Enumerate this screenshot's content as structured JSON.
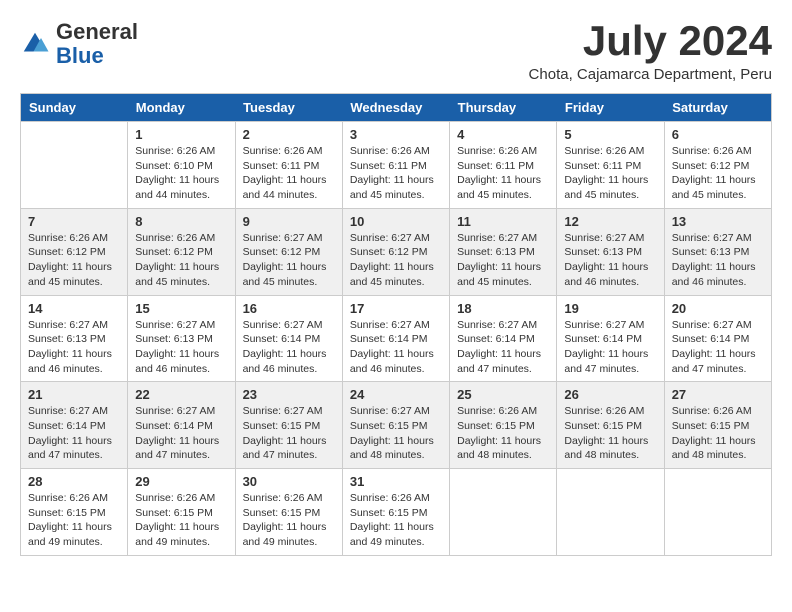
{
  "logo": {
    "general": "General",
    "blue": "Blue"
  },
  "header": {
    "month": "July 2024",
    "location": "Chota, Cajamarca Department, Peru"
  },
  "days": [
    "Sunday",
    "Monday",
    "Tuesday",
    "Wednesday",
    "Thursday",
    "Friday",
    "Saturday"
  ],
  "weeks": [
    [
      {
        "num": "",
        "sunrise": "",
        "sunset": "",
        "daylight": ""
      },
      {
        "num": "1",
        "sunrise": "Sunrise: 6:26 AM",
        "sunset": "Sunset: 6:10 PM",
        "daylight": "Daylight: 11 hours and 44 minutes."
      },
      {
        "num": "2",
        "sunrise": "Sunrise: 6:26 AM",
        "sunset": "Sunset: 6:11 PM",
        "daylight": "Daylight: 11 hours and 44 minutes."
      },
      {
        "num": "3",
        "sunrise": "Sunrise: 6:26 AM",
        "sunset": "Sunset: 6:11 PM",
        "daylight": "Daylight: 11 hours and 45 minutes."
      },
      {
        "num": "4",
        "sunrise": "Sunrise: 6:26 AM",
        "sunset": "Sunset: 6:11 PM",
        "daylight": "Daylight: 11 hours and 45 minutes."
      },
      {
        "num": "5",
        "sunrise": "Sunrise: 6:26 AM",
        "sunset": "Sunset: 6:11 PM",
        "daylight": "Daylight: 11 hours and 45 minutes."
      },
      {
        "num": "6",
        "sunrise": "Sunrise: 6:26 AM",
        "sunset": "Sunset: 6:12 PM",
        "daylight": "Daylight: 11 hours and 45 minutes."
      }
    ],
    [
      {
        "num": "7",
        "sunrise": "Sunrise: 6:26 AM",
        "sunset": "Sunset: 6:12 PM",
        "daylight": "Daylight: 11 hours and 45 minutes."
      },
      {
        "num": "8",
        "sunrise": "Sunrise: 6:26 AM",
        "sunset": "Sunset: 6:12 PM",
        "daylight": "Daylight: 11 hours and 45 minutes."
      },
      {
        "num": "9",
        "sunrise": "Sunrise: 6:27 AM",
        "sunset": "Sunset: 6:12 PM",
        "daylight": "Daylight: 11 hours and 45 minutes."
      },
      {
        "num": "10",
        "sunrise": "Sunrise: 6:27 AM",
        "sunset": "Sunset: 6:12 PM",
        "daylight": "Daylight: 11 hours and 45 minutes."
      },
      {
        "num": "11",
        "sunrise": "Sunrise: 6:27 AM",
        "sunset": "Sunset: 6:13 PM",
        "daylight": "Daylight: 11 hours and 45 minutes."
      },
      {
        "num": "12",
        "sunrise": "Sunrise: 6:27 AM",
        "sunset": "Sunset: 6:13 PM",
        "daylight": "Daylight: 11 hours and 46 minutes."
      },
      {
        "num": "13",
        "sunrise": "Sunrise: 6:27 AM",
        "sunset": "Sunset: 6:13 PM",
        "daylight": "Daylight: 11 hours and 46 minutes."
      }
    ],
    [
      {
        "num": "14",
        "sunrise": "Sunrise: 6:27 AM",
        "sunset": "Sunset: 6:13 PM",
        "daylight": "Daylight: 11 hours and 46 minutes."
      },
      {
        "num": "15",
        "sunrise": "Sunrise: 6:27 AM",
        "sunset": "Sunset: 6:13 PM",
        "daylight": "Daylight: 11 hours and 46 minutes."
      },
      {
        "num": "16",
        "sunrise": "Sunrise: 6:27 AM",
        "sunset": "Sunset: 6:14 PM",
        "daylight": "Daylight: 11 hours and 46 minutes."
      },
      {
        "num": "17",
        "sunrise": "Sunrise: 6:27 AM",
        "sunset": "Sunset: 6:14 PM",
        "daylight": "Daylight: 11 hours and 46 minutes."
      },
      {
        "num": "18",
        "sunrise": "Sunrise: 6:27 AM",
        "sunset": "Sunset: 6:14 PM",
        "daylight": "Daylight: 11 hours and 47 minutes."
      },
      {
        "num": "19",
        "sunrise": "Sunrise: 6:27 AM",
        "sunset": "Sunset: 6:14 PM",
        "daylight": "Daylight: 11 hours and 47 minutes."
      },
      {
        "num": "20",
        "sunrise": "Sunrise: 6:27 AM",
        "sunset": "Sunset: 6:14 PM",
        "daylight": "Daylight: 11 hours and 47 minutes."
      }
    ],
    [
      {
        "num": "21",
        "sunrise": "Sunrise: 6:27 AM",
        "sunset": "Sunset: 6:14 PM",
        "daylight": "Daylight: 11 hours and 47 minutes."
      },
      {
        "num": "22",
        "sunrise": "Sunrise: 6:27 AM",
        "sunset": "Sunset: 6:14 PM",
        "daylight": "Daylight: 11 hours and 47 minutes."
      },
      {
        "num": "23",
        "sunrise": "Sunrise: 6:27 AM",
        "sunset": "Sunset: 6:15 PM",
        "daylight": "Daylight: 11 hours and 47 minutes."
      },
      {
        "num": "24",
        "sunrise": "Sunrise: 6:27 AM",
        "sunset": "Sunset: 6:15 PM",
        "daylight": "Daylight: 11 hours and 48 minutes."
      },
      {
        "num": "25",
        "sunrise": "Sunrise: 6:26 AM",
        "sunset": "Sunset: 6:15 PM",
        "daylight": "Daylight: 11 hours and 48 minutes."
      },
      {
        "num": "26",
        "sunrise": "Sunrise: 6:26 AM",
        "sunset": "Sunset: 6:15 PM",
        "daylight": "Daylight: 11 hours and 48 minutes."
      },
      {
        "num": "27",
        "sunrise": "Sunrise: 6:26 AM",
        "sunset": "Sunset: 6:15 PM",
        "daylight": "Daylight: 11 hours and 48 minutes."
      }
    ],
    [
      {
        "num": "28",
        "sunrise": "Sunrise: 6:26 AM",
        "sunset": "Sunset: 6:15 PM",
        "daylight": "Daylight: 11 hours and 49 minutes."
      },
      {
        "num": "29",
        "sunrise": "Sunrise: 6:26 AM",
        "sunset": "Sunset: 6:15 PM",
        "daylight": "Daylight: 11 hours and 49 minutes."
      },
      {
        "num": "30",
        "sunrise": "Sunrise: 6:26 AM",
        "sunset": "Sunset: 6:15 PM",
        "daylight": "Daylight: 11 hours and 49 minutes."
      },
      {
        "num": "31",
        "sunrise": "Sunrise: 6:26 AM",
        "sunset": "Sunset: 6:15 PM",
        "daylight": "Daylight: 11 hours and 49 minutes."
      },
      {
        "num": "",
        "sunrise": "",
        "sunset": "",
        "daylight": ""
      },
      {
        "num": "",
        "sunrise": "",
        "sunset": "",
        "daylight": ""
      },
      {
        "num": "",
        "sunrise": "",
        "sunset": "",
        "daylight": ""
      }
    ]
  ]
}
